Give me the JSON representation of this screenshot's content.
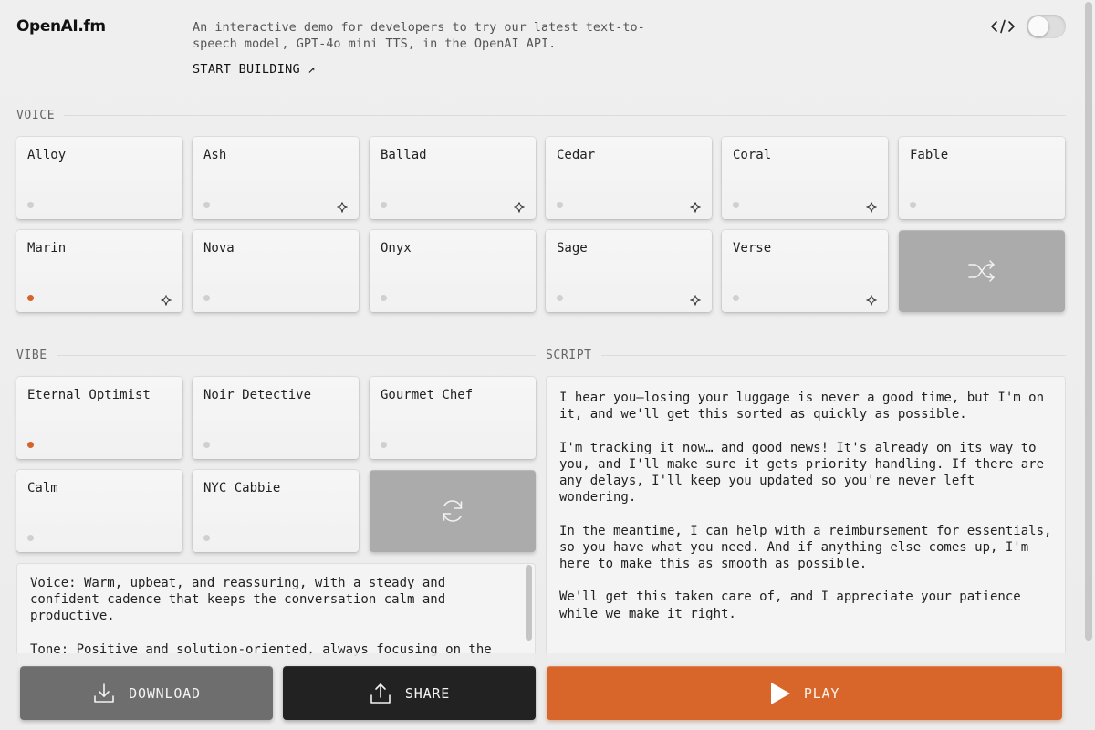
{
  "header": {
    "logo": "OpenAI.fm",
    "tagline": "An interactive demo for developers to try our latest text-to-speech model, GPT-4o mini TTS, in the OpenAI API.",
    "start_link": "START BUILDING ↗"
  },
  "sections": {
    "voice": "VOICE",
    "vibe": "VIBE",
    "script": "SCRIPT"
  },
  "voices": [
    {
      "name": "Alloy",
      "selected": false,
      "new": false
    },
    {
      "name": "Ash",
      "selected": false,
      "new": true
    },
    {
      "name": "Ballad",
      "selected": false,
      "new": true
    },
    {
      "name": "Cedar",
      "selected": false,
      "new": true
    },
    {
      "name": "Coral",
      "selected": false,
      "new": true
    },
    {
      "name": "Fable",
      "selected": false,
      "new": false
    },
    {
      "name": "Marin",
      "selected": true,
      "new": true
    },
    {
      "name": "Nova",
      "selected": false,
      "new": false
    },
    {
      "name": "Onyx",
      "selected": false,
      "new": false
    },
    {
      "name": "Sage",
      "selected": false,
      "new": true
    },
    {
      "name": "Verse",
      "selected": false,
      "new": true
    }
  ],
  "vibes": [
    {
      "name": "Eternal Optimist",
      "selected": true
    },
    {
      "name": "Noir Detective",
      "selected": false
    },
    {
      "name": "Gourmet Chef",
      "selected": false
    },
    {
      "name": "Calm",
      "selected": false
    },
    {
      "name": "NYC Cabbie",
      "selected": false
    }
  ],
  "vibe_text": "Voice: Warm, upbeat, and reassuring, with a steady and confident cadence that keeps the conversation calm and productive.\n\nTone: Positive and solution-oriented, always focusing on the",
  "script_text": "I hear you—losing your luggage is never a good time, but I'm on it, and we'll get this sorted as quickly as possible.\n\nI'm tracking it now… and good news! It's already on its way to you, and I'll make sure it gets priority handling. If there are any delays, I'll keep you updated so you're never left wondering.\n\nIn the meantime, I can help with a reimbursement for essentials, so you have what you need. And if anything else comes up, I'm here to make this as smooth as possible.\n\nWe'll get this taken care of, and I appreciate your patience while we make it right.",
  "buttons": {
    "download": "DOWNLOAD",
    "share": "SHARE",
    "play": "PLAY"
  },
  "colors": {
    "accent": "#d8652a",
    "download_bg": "#6e6e6e",
    "share_bg": "#222222",
    "random_bg": "#ababab"
  },
  "icons": {
    "code": "code-icon",
    "new_voice": "sparkle-icon",
    "random_voice": "shuffle-icon",
    "random_vibe": "refresh-icon",
    "download": "download-icon",
    "share": "share-icon",
    "play": "play-icon"
  }
}
